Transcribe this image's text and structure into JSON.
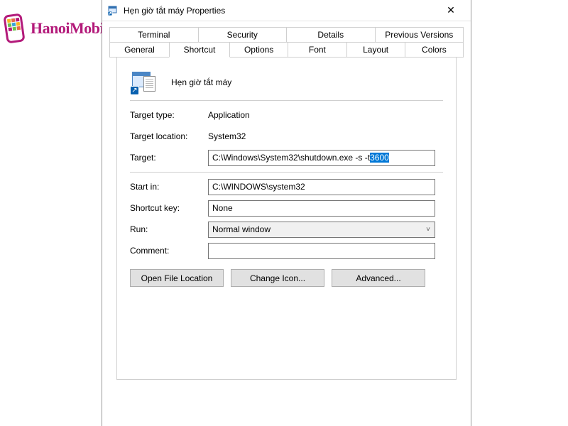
{
  "logo": {
    "text": "HanoiMobile"
  },
  "window": {
    "title": "Hẹn giờ tắt máy Properties"
  },
  "tabs_row1": [
    {
      "label": "Terminal"
    },
    {
      "label": "Security"
    },
    {
      "label": "Details"
    },
    {
      "label": "Previous Versions"
    }
  ],
  "tabs_row2": [
    {
      "label": "General"
    },
    {
      "label": "Shortcut"
    },
    {
      "label": "Options"
    },
    {
      "label": "Font"
    },
    {
      "label": "Layout"
    },
    {
      "label": "Colors"
    }
  ],
  "shortcut": {
    "name": "Hẹn giờ tắt máy",
    "labels": {
      "target_type": "Target type:",
      "target_location": "Target location:",
      "target": "Target:",
      "start_in": "Start in:",
      "shortcut_key": "Shortcut key:",
      "run": "Run:",
      "comment": "Comment:"
    },
    "values": {
      "target_type": "Application",
      "target_location": "System32",
      "target_prefix": "C:\\Windows\\System32\\shutdown.exe -s -t ",
      "target_selected": "3600",
      "start_in": "C:\\WINDOWS\\system32",
      "shortcut_key": "None",
      "run": "Normal window",
      "comment": ""
    }
  },
  "buttons": {
    "open_file_location": "Open File Location",
    "change_icon": "Change Icon...",
    "advanced": "Advanced..."
  }
}
